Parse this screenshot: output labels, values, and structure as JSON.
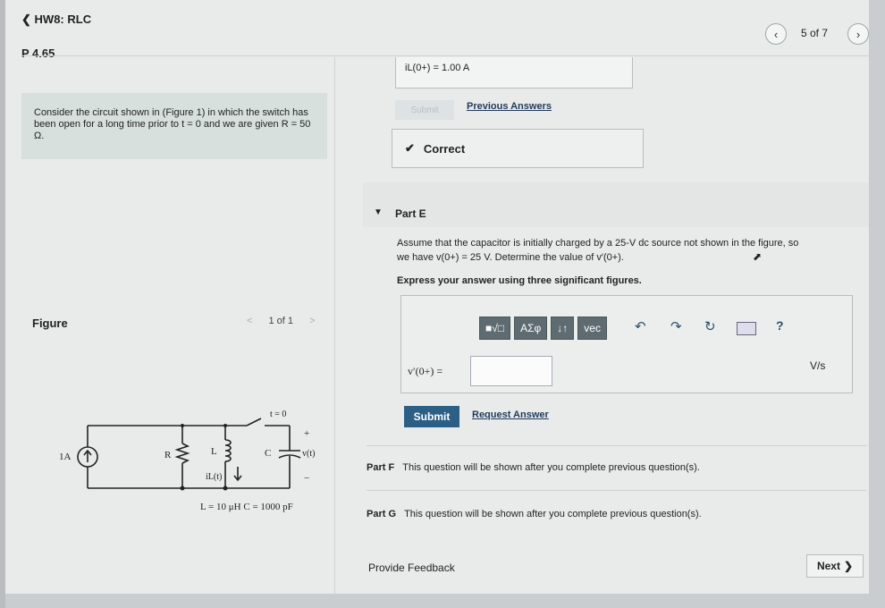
{
  "header": {
    "back_label": "HW8: RLC",
    "problem_label": "P 4.65",
    "pager": "5 of 7"
  },
  "problem": {
    "text": "Consider the circuit shown in (Figure 1) in which the switch has been open for a long time prior to t = 0 and we are given R = 50 Ω."
  },
  "figure": {
    "label": "Figure",
    "pager": "1 of 1",
    "circuit": {
      "source": "1A",
      "resistor": "R",
      "inductor": "L",
      "inductor_current": "iL(t)",
      "capacitor": "C",
      "cap_voltage": "v(t)",
      "switch": "t = 0",
      "plus": "+",
      "minus": "−",
      "values": "L = 10 μH   C = 1000 pF"
    }
  },
  "previous": {
    "answer_text": "iL(0+) =  1.00 A",
    "submit_label": "Submit",
    "previous_answers_label": "Previous Answers",
    "correct_label": "Correct"
  },
  "part_e": {
    "label": "Part E",
    "question_line1": "Assume that the capacitor is initially charged by a 25-V dc source not shown in the figure, so",
    "question_line2": "we have v(0+) = 25 V. Determine the value of v′(0+).",
    "instruction": "Express your answer using three significant figures.",
    "toolbar": {
      "templates": "■√□",
      "greek": "ΑΣφ",
      "arrows": "↓↑",
      "vec": "vec",
      "help": "?"
    },
    "input_label": "v′(0+) =",
    "input_value": "",
    "units": "V/s",
    "submit_label": "Submit",
    "request_answer_label": "Request Answer"
  },
  "part_f": {
    "label": "Part F",
    "text": "This question will be shown after you complete previous question(s)."
  },
  "part_g": {
    "label": "Part G",
    "text": "This question will be shown after you complete previous question(s)."
  },
  "footer": {
    "feedback_label": "Provide Feedback",
    "next_label": "Next"
  }
}
